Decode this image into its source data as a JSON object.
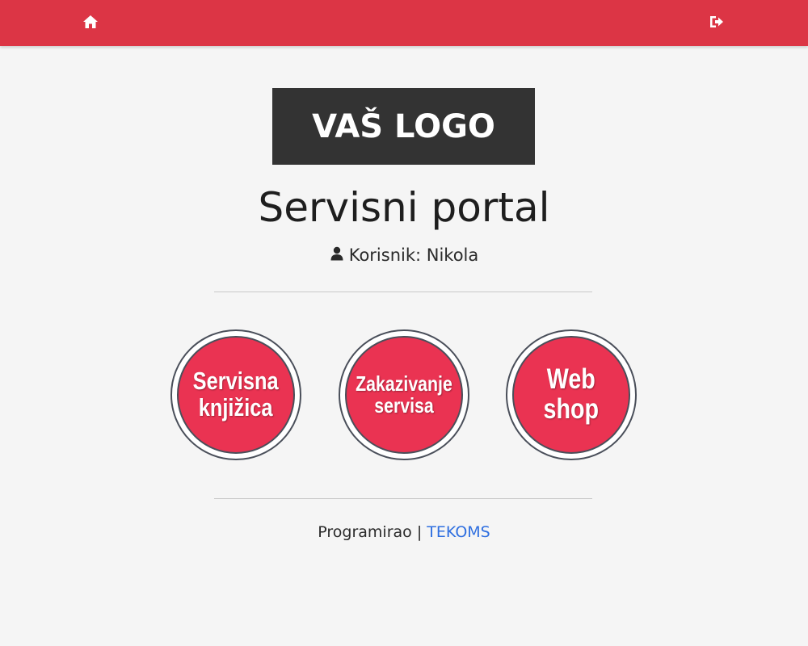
{
  "header": {
    "home_icon": "home-icon",
    "logout_icon": "sign-out-icon",
    "bar_color": "#dc3545"
  },
  "logo": {
    "text": "VAŠ LOGO"
  },
  "page": {
    "title": "Servisni portal",
    "user_label": "Korisnik: Nikola",
    "user_icon": "user-icon"
  },
  "buttons": [
    {
      "line1": "Servisna",
      "line2": "knjižica"
    },
    {
      "line1": "Zakazivanje",
      "line2": "servisa"
    },
    {
      "line1": "Web",
      "line2": "shop"
    }
  ],
  "footer": {
    "prefix": "Programirao | ",
    "link_text": "TEKOMS",
    "link_color": "#2f6fe0"
  }
}
